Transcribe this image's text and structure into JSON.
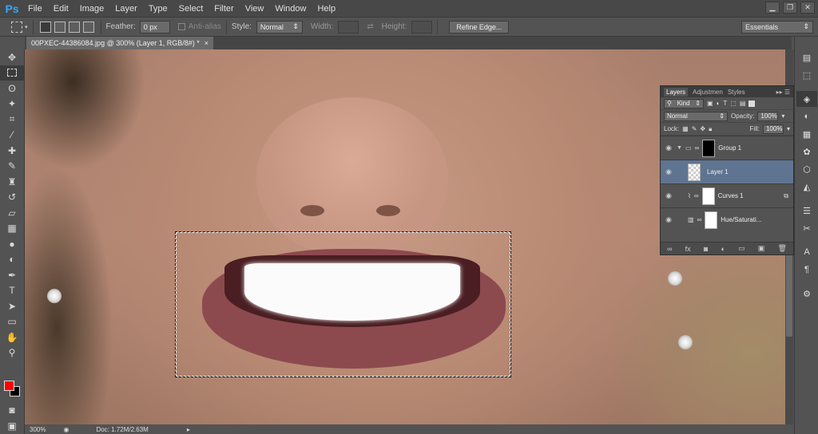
{
  "app": {
    "logo": "Ps"
  },
  "menu": [
    "File",
    "Edit",
    "Image",
    "Layer",
    "Type",
    "Select",
    "Filter",
    "View",
    "Window",
    "Help"
  ],
  "window_controls": [
    "minimize-icon",
    "restore-icon",
    "close-icon"
  ],
  "options_bar": {
    "feather_label": "Feather:",
    "feather_value": "0 px",
    "antialias_label": "Anti-alias",
    "style_label": "Style:",
    "style_value": "Normal",
    "width_label": "Width:",
    "height_label": "Height:",
    "refine_edge": "Refine Edge...",
    "workspace": "Essentials"
  },
  "document_tab": {
    "title": "00PXEC-44386084.jpg @ 300% (Layer 1, RGB/8#) *",
    "close": "×"
  },
  "colors": {
    "foreground": "#ff0000",
    "background": "#000000"
  },
  "status": {
    "zoom": "300%",
    "doc": "Doc: 1.72M/2.63M"
  },
  "layers_panel": {
    "tabs": [
      "Layers",
      "Adjustmen",
      "Styles"
    ],
    "filter_kind": "Kind",
    "blend_mode": "Normal",
    "opacity_label": "Opacity:",
    "opacity_value": "100%",
    "lock_label": "Lock:",
    "fill_label": "Fill:",
    "fill_value": "100%",
    "layers": [
      {
        "name": "Group 1",
        "type": "group"
      },
      {
        "name": "Layer 1",
        "type": "pixel",
        "selected": true
      },
      {
        "name": "Curves 1",
        "type": "adjustment"
      },
      {
        "name": "Hue/Saturati...",
        "type": "adjustment"
      }
    ]
  }
}
